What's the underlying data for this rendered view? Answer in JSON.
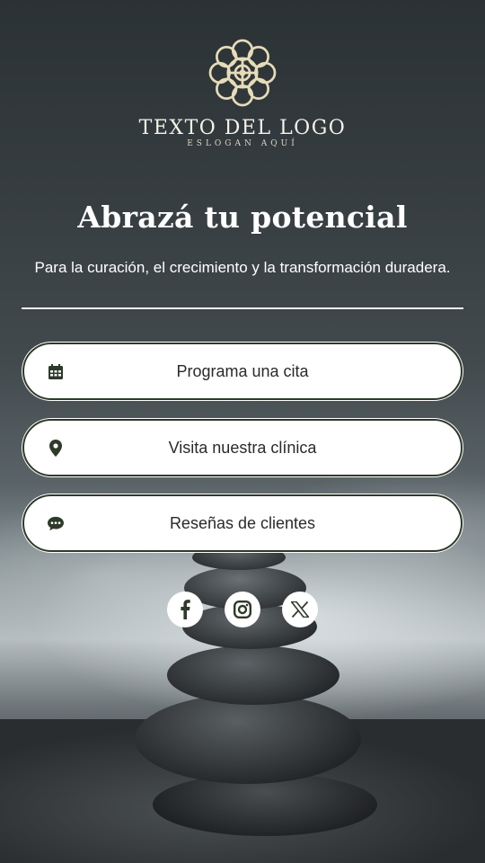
{
  "logo": {
    "text": "TEXTO DEL LOGO",
    "slogan": "ESLOGAN AQUÍ",
    "icon": "mandala-logo-icon",
    "color": "#e6dcb8"
  },
  "hero": {
    "title": "Abrazá tu potencial",
    "subtitle": "Para la curación, el crecimiento y la transformación duradera."
  },
  "actions": [
    {
      "label": "Programa una cita",
      "icon": "calendar-icon"
    },
    {
      "label": "Visita nuestra clínica",
      "icon": "map-pin-icon"
    },
    {
      "label": "Reseñas de clientes",
      "icon": "chat-bubble-icon"
    }
  ],
  "social": [
    {
      "icon": "facebook-icon"
    },
    {
      "icon": "instagram-icon"
    },
    {
      "icon": "x-icon"
    }
  ],
  "colors": {
    "button_background": "#ffffff",
    "button_border": "#2e3a2a",
    "button_text": "#2a2a2a",
    "icon": "#2e3a2a",
    "heading_text": "#ffffff"
  }
}
